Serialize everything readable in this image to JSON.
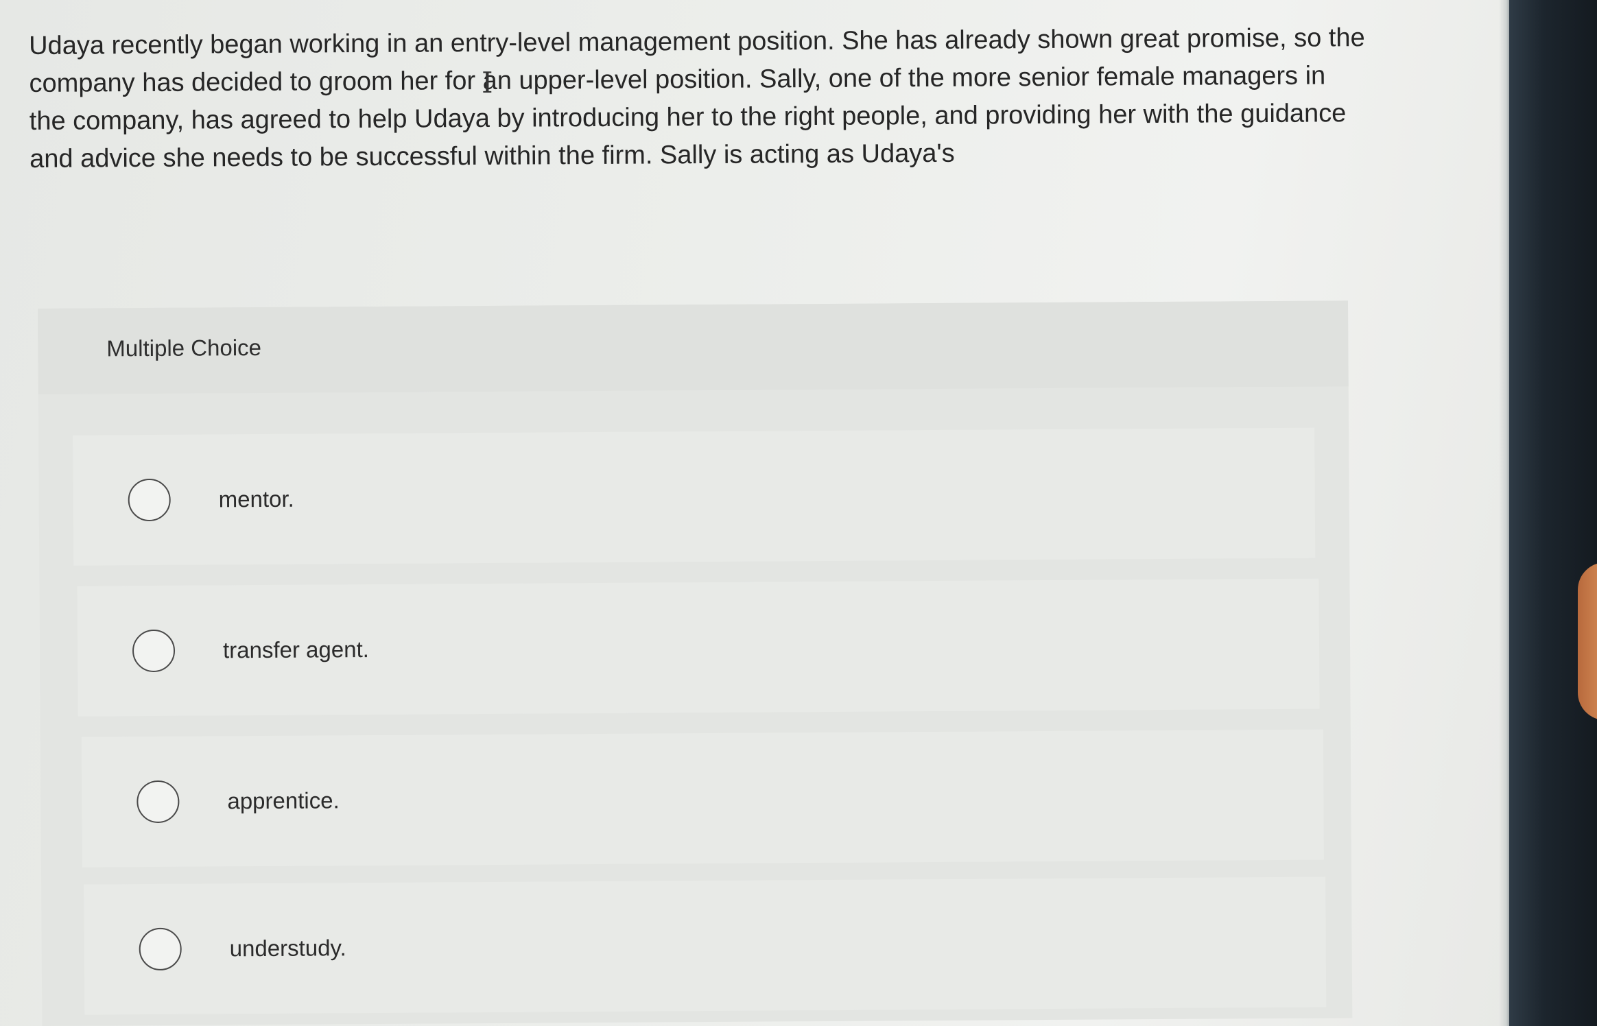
{
  "question": {
    "text": "Udaya recently began working in an entry-level management position. She has already shown great promise, so the company has decided to groom her for an upper-level position. Sally, one of the more senior female managers in the company, has agreed to help Udaya by introducing her to the right people, and providing her with the guidance and advice she needs to be successful within the firm. Sally is acting as Udaya's"
  },
  "multiple_choice": {
    "label": "Multiple Choice",
    "options": [
      {
        "label": "mentor."
      },
      {
        "label": "transfer agent."
      },
      {
        "label": "apprentice."
      },
      {
        "label": "understudy."
      }
    ]
  },
  "cursor": {
    "icon": "text-cursor-icon",
    "glyph": "I"
  }
}
